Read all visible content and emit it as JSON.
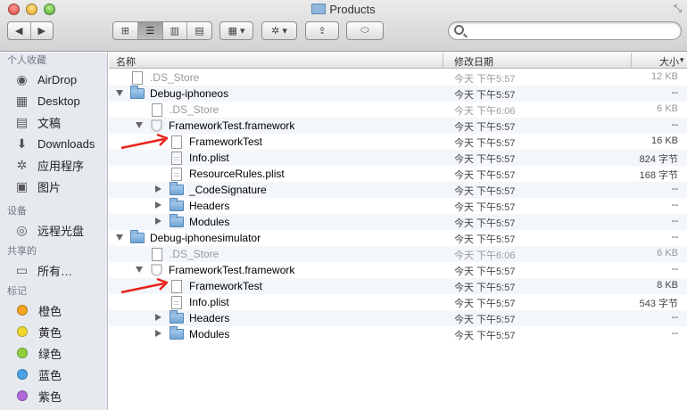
{
  "window": {
    "title": "Products"
  },
  "toolbar": {
    "back": "◀",
    "forward": "▶",
    "views": [
      "⊞",
      "☰",
      "▥",
      "▤"
    ],
    "arrange": "▦ ▾",
    "action": "✲ ▾",
    "share": "⇪",
    "tags": "⬭"
  },
  "search": {
    "placeholder": ""
  },
  "sidebar": {
    "favorites_header": "个人收藏",
    "favorites": [
      {
        "label": "AirDrop",
        "icon": "airdrop-icon"
      },
      {
        "label": "Desktop",
        "icon": "desktop-icon"
      },
      {
        "label": "文稿",
        "icon": "documents-icon"
      },
      {
        "label": "Downloads",
        "icon": "downloads-icon"
      },
      {
        "label": "应用程序",
        "icon": "applications-icon"
      },
      {
        "label": "图片",
        "icon": "pictures-icon"
      }
    ],
    "devices_header": "设备",
    "devices": [
      {
        "label": "远程光盘",
        "icon": "remote-disc-icon"
      }
    ],
    "shared_header": "共享的",
    "shared": [
      {
        "label": "所有…",
        "icon": "network-icon"
      }
    ],
    "tags_header": "标记",
    "tags": [
      {
        "label": "橙色",
        "color": "#f5a623"
      },
      {
        "label": "黄色",
        "color": "#f0d830"
      },
      {
        "label": "绿色",
        "color": "#8fcf3c"
      },
      {
        "label": "蓝色",
        "color": "#4aa3e8"
      },
      {
        "label": "紫色",
        "color": "#b36ad8"
      }
    ]
  },
  "columns": {
    "name": "名称",
    "date": "修改日期",
    "size": "大小",
    "sort_indicator": "▾"
  },
  "files": [
    {
      "name": ".DS_Store",
      "date": "今天 下午5:57",
      "size": "12 KB",
      "level": 0,
      "type": "doc",
      "dim": true
    },
    {
      "name": "Debug-iphoneos",
      "date": "今天 下午5:57",
      "size": "--",
      "level": 0,
      "type": "folder",
      "expand": "open"
    },
    {
      "name": ".DS_Store",
      "date": "今天 下午6:06",
      "size": "6 KB",
      "level": 1,
      "type": "doc",
      "dim": true
    },
    {
      "name": "FrameworkTest.framework",
      "date": "今天 下午5:57",
      "size": "--",
      "level": 1,
      "type": "shield",
      "expand": "open"
    },
    {
      "name": "FrameworkTest",
      "date": "今天 下午5:57",
      "size": "16 KB",
      "level": 2,
      "type": "doc",
      "arrow": true
    },
    {
      "name": "Info.plist",
      "date": "今天 下午5:57",
      "size": "824 字节",
      "level": 2,
      "type": "doclines"
    },
    {
      "name": "ResourceRules.plist",
      "date": "今天 下午5:57",
      "size": "168 字节",
      "level": 2,
      "type": "doclines"
    },
    {
      "name": "_CodeSignature",
      "date": "今天 下午5:57",
      "size": "--",
      "level": 2,
      "type": "folder",
      "expand": "closed"
    },
    {
      "name": "Headers",
      "date": "今天 下午5:57",
      "size": "--",
      "level": 2,
      "type": "folder",
      "expand": "closed"
    },
    {
      "name": "Modules",
      "date": "今天 下午5:57",
      "size": "--",
      "level": 2,
      "type": "folder",
      "expand": "closed"
    },
    {
      "name": "Debug-iphonesimulator",
      "date": "今天 下午5:57",
      "size": "--",
      "level": 0,
      "type": "folder",
      "expand": "open"
    },
    {
      "name": ".DS_Store",
      "date": "今天 下午6:06",
      "size": "6 KB",
      "level": 1,
      "type": "doc",
      "dim": true
    },
    {
      "name": "FrameworkTest.framework",
      "date": "今天 下午5:57",
      "size": "--",
      "level": 1,
      "type": "shield",
      "expand": "open"
    },
    {
      "name": "FrameworkTest",
      "date": "今天 下午5:57",
      "size": "8 KB",
      "level": 2,
      "type": "doc",
      "arrow": true
    },
    {
      "name": "Info.plist",
      "date": "今天 下午5:57",
      "size": "543 字节",
      "level": 2,
      "type": "doclines"
    },
    {
      "name": "Headers",
      "date": "今天 下午5:57",
      "size": "--",
      "level": 2,
      "type": "folder",
      "expand": "closed"
    },
    {
      "name": "Modules",
      "date": "今天 下午5:57",
      "size": "--",
      "level": 2,
      "type": "folder",
      "expand": "closed"
    }
  ]
}
